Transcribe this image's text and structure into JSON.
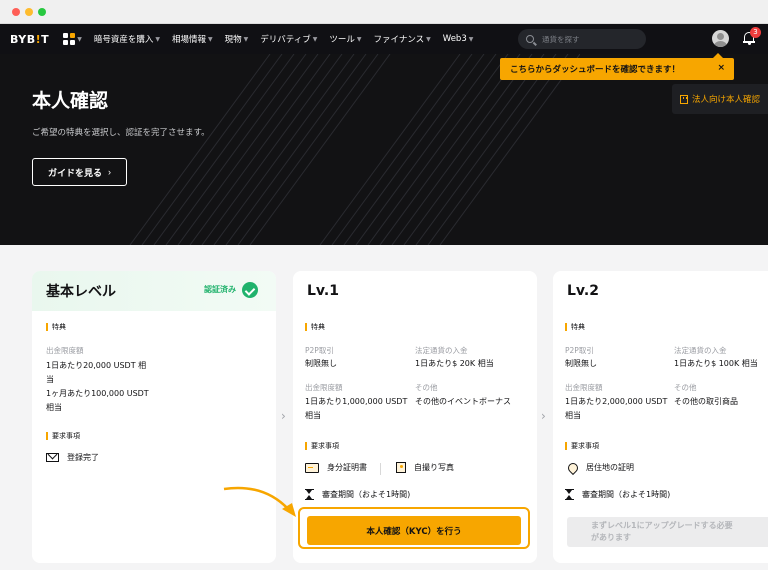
{
  "navbar": {
    "logo_main": "BYB",
    "logo_accent": "!",
    "logo_end": "T",
    "items": [
      "暗号資産を購入",
      "相場情報",
      "現物",
      "デリバティブ",
      "ツール",
      "ファイナンス",
      "Web3"
    ],
    "search_placeholder": "通貨を探す",
    "notification_count": "3"
  },
  "tooltip": {
    "text": "こちらからダッシュボードを確認できます！",
    "close": "×"
  },
  "hero": {
    "title": "本人確認",
    "subtitle": "ご希望の特典を選択し、認証を完了させます。",
    "guide_button": "ガイドを見る",
    "guide_chevron": "›",
    "corporate_button": "法人向け本人確認"
  },
  "basic": {
    "title": "基本レベル",
    "status": "認証済み",
    "benefits_label": "特典",
    "withdraw_label": "出金限度額",
    "withdraw_line1": "1日あたり20,000 USDT 相",
    "withdraw_line2": "当",
    "withdraw_line3": "1ヶ月あたり100,000 USDT",
    "withdraw_line4": "相当",
    "requirements_label": "要求事項",
    "requirement": "登録完了"
  },
  "lv1": {
    "title": "Lv.1",
    "benefits_label": "特典",
    "p2p_label": "P2P取引",
    "p2p_value": "制限無し",
    "fiat_label": "法定通貨の入金",
    "fiat_value": "1日あたり$ 20K 相当",
    "withdraw_label": "出金限度額",
    "withdraw_line1": "1日あたり1,000,000 USDT",
    "withdraw_line2": "相当",
    "other_label": "その他",
    "other_value": "その他のイベントボーナス",
    "requirements_label": "要求事項",
    "req_id": "身分証明書",
    "req_selfie": "自撮り写真",
    "review": "審査期間（およそ1時間)",
    "kyc_button": "本人確認（KYC）を行う"
  },
  "lv2": {
    "title": "Lv.2",
    "benefits_label": "特典",
    "p2p_label": "P2P取引",
    "p2p_value": "制限無し",
    "fiat_label": "法定通貨の入金",
    "fiat_value": "1日あたり$ 100K 相当",
    "withdraw_label": "出金限度額",
    "withdraw_line1": "1日あたり2,000,000 USDT",
    "withdraw_line2": "相当",
    "other_label": "その他",
    "other_value": "その他の取引商品",
    "requirements_label": "要求事項",
    "req_address": "居住地の証明",
    "review": "審査期間（およそ1時間)",
    "locked_line1": "まずレベル1にアップグレードする必要",
    "locked_line2": "があります"
  },
  "chevron": "›",
  "colors": {
    "accent": "#f7a600",
    "success": "#20b26c",
    "hero_bg": "#121214"
  }
}
